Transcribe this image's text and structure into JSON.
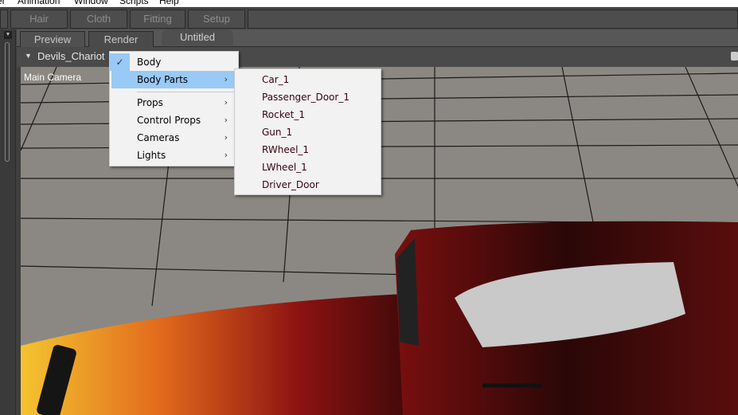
{
  "menubar": {
    "items": [
      "er",
      "Animation",
      "Window",
      "Scripts",
      "Help"
    ]
  },
  "panel_tabs": [
    "Hair",
    "Cloth",
    "Fitting",
    "Setup"
  ],
  "doc_tabs": {
    "preview": "Preview",
    "render": "Render",
    "title": "Untitled"
  },
  "viewport": {
    "scene_name": "Devils_Chariot",
    "camera": "Main Camera"
  },
  "context_menu": {
    "items": [
      {
        "label": "Body",
        "checked": true
      },
      {
        "label": "Body Parts",
        "submenu": true,
        "highlighted": true
      },
      {
        "label": "Props",
        "submenu": true
      },
      {
        "label": "Control Props",
        "submenu": true
      },
      {
        "label": "Cameras",
        "submenu": true
      },
      {
        "label": "Lights",
        "submenu": true
      }
    ],
    "check_glyph": "✓",
    "arrow_glyph": "›"
  },
  "submenu": {
    "items": [
      "Car_1",
      "Passenger_Door_1",
      "Rocket_1",
      "Gun_1",
      "RWheel_1",
      "LWheel_1",
      "Driver_Door"
    ]
  },
  "colors": {
    "highlight": "#99c9f5",
    "menu_bg": "#f2f2f2",
    "floor": "#8a8782"
  }
}
